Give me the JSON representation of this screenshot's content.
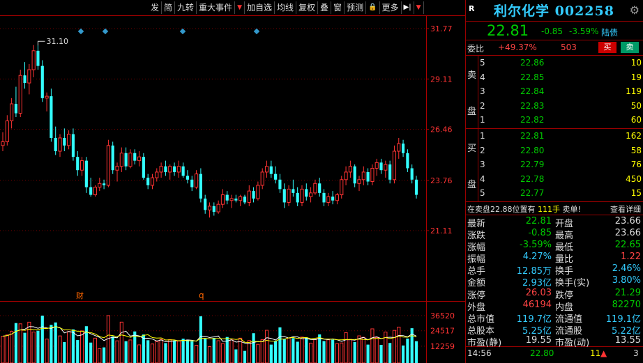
{
  "toolbar": {
    "items": [
      "发",
      "简",
      "九转",
      "重大事件",
      "加自选",
      "均线",
      "复权",
      "叠",
      "窗",
      "预测",
      "",
      "更多",
      ""
    ]
  },
  "chart_data": {
    "type": "candlestick",
    "price_axis": {
      "labels": [
        "31.77",
        "29.11",
        "26.46",
        "23.76",
        "21.11"
      ],
      "values": [
        31.77,
        29.11,
        26.46,
        23.76,
        21.11
      ]
    },
    "volume_axis": {
      "labels": [
        "36520",
        "24517",
        "12259"
      ],
      "values": [
        36520,
        24517,
        12259
      ]
    },
    "annotations": {
      "high_label": "31.10",
      "marker_cai": "财",
      "marker_q": "q"
    },
    "up_color": "#ff3333",
    "down_color": "#33ffff",
    "candles": [
      {
        "o": 25.6,
        "h": 26.3,
        "l": 25.3,
        "c": 25.8
      },
      {
        "o": 25.8,
        "h": 27.2,
        "l": 25.6,
        "c": 26.9
      },
      {
        "o": 26.9,
        "h": 28.1,
        "l": 26.5,
        "c": 27.8
      },
      {
        "o": 27.8,
        "h": 28.7,
        "l": 27.1,
        "c": 27.3
      },
      {
        "o": 27.3,
        "h": 29.6,
        "l": 27.1,
        "c": 29.3
      },
      {
        "o": 29.3,
        "h": 30.0,
        "l": 28.6,
        "c": 28.9
      },
      {
        "o": 28.9,
        "h": 29.9,
        "l": 28.3,
        "c": 29.6
      },
      {
        "o": 29.6,
        "h": 30.9,
        "l": 29.2,
        "c": 30.6
      },
      {
        "o": 30.6,
        "h": 31.1,
        "l": 29.6,
        "c": 29.8
      },
      {
        "o": 29.8,
        "h": 30.1,
        "l": 27.9,
        "c": 28.1
      },
      {
        "o": 28.1,
        "h": 28.4,
        "l": 27.4,
        "c": 28.2
      },
      {
        "o": 28.2,
        "h": 28.6,
        "l": 25.8,
        "c": 26.0
      },
      {
        "o": 26.0,
        "h": 26.6,
        "l": 25.1,
        "c": 25.3
      },
      {
        "o": 25.3,
        "h": 26.2,
        "l": 25.0,
        "c": 26.0
      },
      {
        "o": 26.0,
        "h": 26.5,
        "l": 25.3,
        "c": 25.6
      },
      {
        "o": 25.6,
        "h": 26.4,
        "l": 25.4,
        "c": 26.2
      },
      {
        "o": 26.2,
        "h": 26.5,
        "l": 24.8,
        "c": 25.0
      },
      {
        "o": 25.0,
        "h": 25.3,
        "l": 24.0,
        "c": 24.3
      },
      {
        "o": 24.3,
        "h": 25.0,
        "l": 24.0,
        "c": 24.8
      },
      {
        "o": 24.8,
        "h": 25.0,
        "l": 23.1,
        "c": 23.4
      },
      {
        "o": 23.4,
        "h": 23.9,
        "l": 22.9,
        "c": 23.0
      },
      {
        "o": 23.0,
        "h": 23.5,
        "l": 22.9,
        "c": 23.4
      },
      {
        "o": 23.4,
        "h": 23.9,
        "l": 23.2,
        "c": 23.6
      },
      {
        "o": 23.6,
        "h": 23.8,
        "l": 23.3,
        "c": 23.5
      },
      {
        "o": 23.5,
        "h": 25.9,
        "l": 23.4,
        "c": 25.6
      },
      {
        "o": 25.6,
        "h": 25.8,
        "l": 24.1,
        "c": 24.3
      },
      {
        "o": 24.3,
        "h": 24.7,
        "l": 23.7,
        "c": 24.5
      },
      {
        "o": 24.5,
        "h": 25.5,
        "l": 24.2,
        "c": 25.2
      },
      {
        "o": 25.2,
        "h": 25.5,
        "l": 24.3,
        "c": 24.5
      },
      {
        "o": 24.5,
        "h": 25.4,
        "l": 24.4,
        "c": 25.2
      },
      {
        "o": 25.2,
        "h": 25.4,
        "l": 24.6,
        "c": 24.8
      },
      {
        "o": 24.8,
        "h": 25.3,
        "l": 24.5,
        "c": 25.0
      },
      {
        "o": 25.0,
        "h": 25.2,
        "l": 23.8,
        "c": 23.9
      },
      {
        "o": 23.9,
        "h": 24.1,
        "l": 23.3,
        "c": 23.5
      },
      {
        "o": 23.5,
        "h": 24.1,
        "l": 23.3,
        "c": 23.9
      },
      {
        "o": 23.9,
        "h": 24.4,
        "l": 23.7,
        "c": 24.2
      },
      {
        "o": 24.2,
        "h": 24.7,
        "l": 23.9,
        "c": 24.5
      },
      {
        "o": 24.5,
        "h": 24.8,
        "l": 24.0,
        "c": 24.2
      },
      {
        "o": 24.2,
        "h": 24.6,
        "l": 23.8,
        "c": 24.5
      },
      {
        "o": 24.5,
        "h": 24.7,
        "l": 24.0,
        "c": 24.2
      },
      {
        "o": 24.2,
        "h": 24.8,
        "l": 23.9,
        "c": 24.5
      },
      {
        "o": 24.5,
        "h": 24.7,
        "l": 23.9,
        "c": 24.0
      },
      {
        "o": 24.0,
        "h": 24.3,
        "l": 23.6,
        "c": 23.8
      },
      {
        "o": 23.8,
        "h": 24.0,
        "l": 23.2,
        "c": 23.4
      },
      {
        "o": 23.4,
        "h": 24.3,
        "l": 23.3,
        "c": 24.1
      },
      {
        "o": 24.1,
        "h": 24.4,
        "l": 22.6,
        "c": 22.8
      },
      {
        "o": 22.8,
        "h": 23.0,
        "l": 22.0,
        "c": 22.2
      },
      {
        "o": 22.2,
        "h": 22.6,
        "l": 21.8,
        "c": 22.4
      },
      {
        "o": 22.4,
        "h": 22.6,
        "l": 21.9,
        "c": 22.1
      },
      {
        "o": 22.1,
        "h": 22.7,
        "l": 22.0,
        "c": 22.5
      },
      {
        "o": 22.5,
        "h": 23.3,
        "l": 22.3,
        "c": 23.0
      },
      {
        "o": 23.0,
        "h": 23.2,
        "l": 22.5,
        "c": 22.7
      },
      {
        "o": 22.7,
        "h": 23.0,
        "l": 22.3,
        "c": 22.8
      },
      {
        "o": 22.8,
        "h": 23.0,
        "l": 22.6,
        "c": 22.7
      },
      {
        "o": 22.7,
        "h": 23.0,
        "l": 22.4,
        "c": 22.9
      },
      {
        "o": 22.9,
        "h": 23.0,
        "l": 22.5,
        "c": 22.6
      },
      {
        "o": 22.6,
        "h": 23.5,
        "l": 22.4,
        "c": 23.2
      },
      {
        "o": 23.2,
        "h": 23.4,
        "l": 22.6,
        "c": 22.8
      },
      {
        "o": 22.8,
        "h": 23.7,
        "l": 22.7,
        "c": 23.5
      },
      {
        "o": 23.5,
        "h": 24.4,
        "l": 23.3,
        "c": 24.2
      },
      {
        "o": 24.2,
        "h": 24.8,
        "l": 23.9,
        "c": 24.5
      },
      {
        "o": 24.5,
        "h": 24.8,
        "l": 23.9,
        "c": 24.1
      },
      {
        "o": 24.1,
        "h": 24.5,
        "l": 23.6,
        "c": 23.8
      },
      {
        "o": 23.8,
        "h": 24.1,
        "l": 23.1,
        "c": 23.3
      },
      {
        "o": 23.3,
        "h": 23.6,
        "l": 22.3,
        "c": 22.6
      },
      {
        "o": 22.6,
        "h": 23.5,
        "l": 22.4,
        "c": 23.3
      },
      {
        "o": 23.3,
        "h": 23.8,
        "l": 22.9,
        "c": 23.1
      },
      {
        "o": 23.1,
        "h": 23.4,
        "l": 22.4,
        "c": 22.6
      },
      {
        "o": 22.6,
        "h": 23.5,
        "l": 22.4,
        "c": 23.3
      },
      {
        "o": 23.3,
        "h": 23.6,
        "l": 22.7,
        "c": 22.9
      },
      {
        "o": 22.9,
        "h": 23.4,
        "l": 22.6,
        "c": 23.1
      },
      {
        "o": 23.1,
        "h": 23.8,
        "l": 23.0,
        "c": 23.6
      },
      {
        "o": 23.6,
        "h": 23.9,
        "l": 22.9,
        "c": 23.1
      },
      {
        "o": 23.1,
        "h": 23.3,
        "l": 22.4,
        "c": 22.6
      },
      {
        "o": 22.6,
        "h": 23.1,
        "l": 22.4,
        "c": 22.9
      },
      {
        "o": 22.9,
        "h": 23.2,
        "l": 22.5,
        "c": 22.7
      },
      {
        "o": 22.7,
        "h": 23.1,
        "l": 22.5,
        "c": 23.0
      },
      {
        "o": 23.0,
        "h": 24.0,
        "l": 22.8,
        "c": 23.8
      },
      {
        "o": 23.8,
        "h": 24.5,
        "l": 23.5,
        "c": 24.2
      },
      {
        "o": 24.2,
        "h": 24.8,
        "l": 23.9,
        "c": 24.5
      },
      {
        "o": 24.5,
        "h": 24.6,
        "l": 23.4,
        "c": 23.6
      },
      {
        "o": 23.6,
        "h": 24.0,
        "l": 23.2,
        "c": 23.8
      },
      {
        "o": 23.8,
        "h": 24.5,
        "l": 23.5,
        "c": 24.2
      },
      {
        "o": 24.2,
        "h": 24.4,
        "l": 23.5,
        "c": 23.7
      },
      {
        "o": 23.7,
        "h": 24.6,
        "l": 23.5,
        "c": 24.4
      },
      {
        "o": 24.4,
        "h": 24.9,
        "l": 24.0,
        "c": 24.7
      },
      {
        "o": 24.7,
        "h": 24.9,
        "l": 24.1,
        "c": 24.3
      },
      {
        "o": 24.3,
        "h": 24.8,
        "l": 23.9,
        "c": 24.6
      },
      {
        "o": 24.6,
        "h": 24.8,
        "l": 23.6,
        "c": 23.8
      },
      {
        "o": 23.8,
        "h": 25.6,
        "l": 23.6,
        "c": 25.3
      },
      {
        "o": 25.3,
        "h": 26.0,
        "l": 24.9,
        "c": 25.7
      },
      {
        "o": 25.7,
        "h": 25.9,
        "l": 25.0,
        "c": 25.2
      },
      {
        "o": 25.2,
        "h": 25.4,
        "l": 24.2,
        "c": 24.4
      },
      {
        "o": 24.4,
        "h": 24.6,
        "l": 23.6,
        "c": 23.8
      },
      {
        "o": 23.8,
        "h": 24.0,
        "l": 22.8,
        "c": 23.0
      }
    ]
  },
  "panel": {
    "r": "R",
    "name": "利尔化学",
    "code": "002258",
    "price": "22.81",
    "change": "-0.85",
    "change_pct": "-3.59%",
    "tag": "陆债",
    "weibi_label": "委比",
    "weibi_pct": "+49.37%",
    "weibi_num": "503",
    "buy_btn": "买",
    "sell_btn": "卖",
    "sell_side": "卖盘",
    "buy_side": "买盘",
    "sells": [
      {
        "lv": "5",
        "price": "22.86",
        "qty": "10"
      },
      {
        "lv": "4",
        "price": "22.85",
        "qty": "19"
      },
      {
        "lv": "3",
        "price": "22.84",
        "qty": "119"
      },
      {
        "lv": "2",
        "price": "22.83",
        "qty": "50"
      },
      {
        "lv": "1",
        "price": "22.82",
        "qty": "60"
      }
    ],
    "buys": [
      {
        "lv": "1",
        "price": "22.81",
        "qty": "162"
      },
      {
        "lv": "2",
        "price": "22.80",
        "qty": "58"
      },
      {
        "lv": "3",
        "price": "22.79",
        "qty": "76"
      },
      {
        "lv": "4",
        "price": "22.78",
        "qty": "450"
      },
      {
        "lv": "5",
        "price": "22.77",
        "qty": "15"
      }
    ],
    "note": {
      "pre": "在卖盘22.88位置有 ",
      "num": "111手",
      "post": " 卖单!",
      "link": "查看详细"
    },
    "stats": [
      [
        "最新",
        "22.81",
        "#0c0",
        "开盘",
        "23.66",
        "#ddd"
      ],
      [
        "涨跌",
        "-0.85",
        "#0c0",
        "最高",
        "23.66",
        "#ddd"
      ],
      [
        "涨幅",
        "-3.59%",
        "#0c0",
        "最低",
        "22.65",
        "#0c0"
      ],
      [
        "振幅",
        "4.27%",
        "#3cf",
        "量比",
        "1.22",
        "#f44"
      ],
      [
        "总手",
        "12.85万",
        "#3cf",
        "换手",
        "2.46%",
        "#3cf"
      ],
      [
        "金额",
        "2.93亿",
        "#3cf",
        "换手(实)",
        "3.80%",
        "#3cf"
      ],
      [
        "涨停",
        "26.03",
        "#f44",
        "跌停",
        "21.29",
        "#0c0"
      ],
      [
        "外盘",
        "46194",
        "#f44",
        "内盘",
        "82270",
        "#0c0"
      ],
      [
        "总市值",
        "119.7亿",
        "#3cf",
        "流通值",
        "119.1亿",
        "#3cf"
      ],
      [
        "总股本",
        "5.25亿",
        "#3cf",
        "流通股",
        "5.22亿",
        "#3cf"
      ],
      [
        "市盈(静)",
        "19.55",
        "#ddd",
        "市盈(动)",
        "13.55",
        "#ddd"
      ]
    ],
    "footer": {
      "time": "14:56",
      "price": "22.80",
      "qty": "11",
      "num": "3"
    }
  }
}
